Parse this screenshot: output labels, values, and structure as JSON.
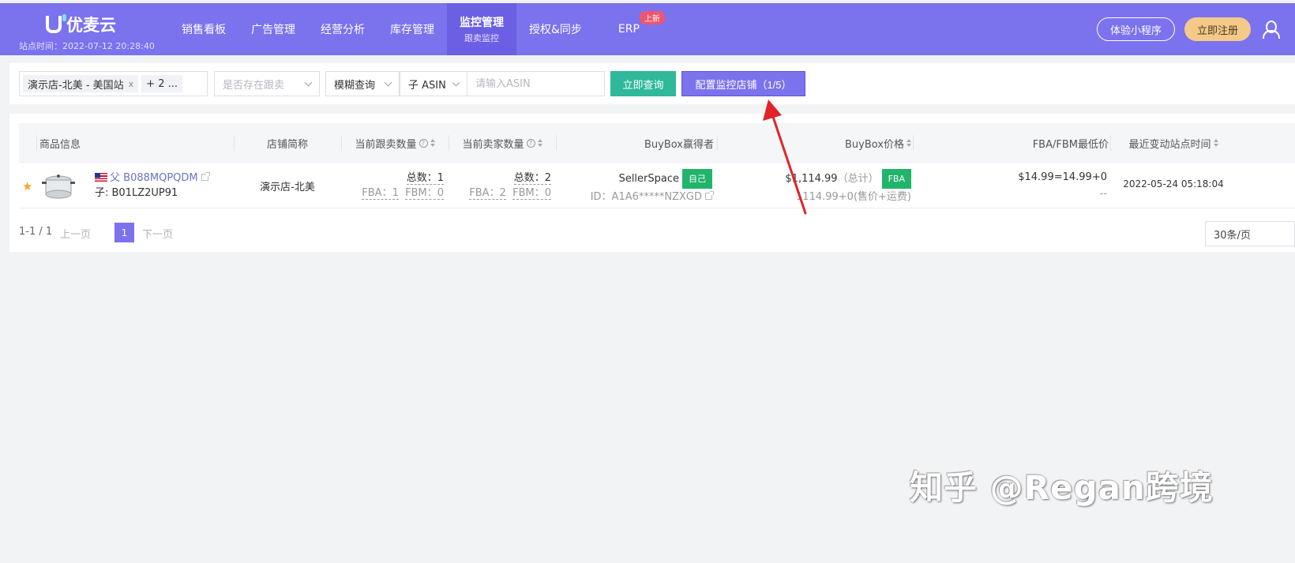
{
  "app": {
    "brand_name": "优麦云",
    "site_time": "站点时间：2022-07-12 20:28:40"
  },
  "nav": [
    {
      "label": "销售看板",
      "sub": ""
    },
    {
      "label": "广告管理",
      "sub": ""
    },
    {
      "label": "经营分析",
      "sub": ""
    },
    {
      "label": "库存管理",
      "sub": ""
    },
    {
      "label": "监控管理",
      "sub": "跟卖监控",
      "active": true
    },
    {
      "label": "授权&同步",
      "sub": ""
    },
    {
      "label": "ERP",
      "sub": "",
      "badge": "上新"
    }
  ],
  "top_actions": {
    "mini_program": "体验小程序",
    "register": "立即注册"
  },
  "filters": {
    "store_tag": "演示店-北美 - 美国站",
    "store_more": "+ 2 ...",
    "follow_select": "是否存在跟卖",
    "match_mode": "模糊查询",
    "asin_type": "子 ASIN",
    "asin_placeholder": "请输入ASIN",
    "query_button": "立即查询",
    "config_button": "配置监控店铺（1/5）"
  },
  "table": {
    "headers": {
      "product": "商品信息",
      "store": "店铺简称",
      "follow_count": "当前跟卖数量",
      "seller_count": "当前卖家数量",
      "buybox_winner": "BuyBox赢得者",
      "buybox_price": "BuyBox价格",
      "min_price": "FBA/FBM最低价",
      "last_change": "最近变动站点时间"
    },
    "rows": [
      {
        "parent_prefix": "父",
        "parent_asin": "B088MQPQDM",
        "child_asin": "子: B01LZ2UP91",
        "store": "演示店-北美",
        "follow_total": "总数：1",
        "follow_fba": "FBA：1",
        "follow_fbm": "FBM：0",
        "seller_total": "总数：2",
        "seller_fba": "FBA：2",
        "seller_fbm": "FBM：0",
        "winner_name": "SellerSpace",
        "winner_tag": "自己",
        "winner_id": "ID：A1A6*****NZXGD",
        "price_total": "$1,114.99",
        "price_total_note": "（总计）",
        "price_tag": "FBA",
        "price_detail": "1114.99+0(售价+运费)",
        "min_price": "$14.99=14.99+0",
        "min_price_sub": "--",
        "last_change": "2022-05-24 05:18:04"
      }
    ]
  },
  "pager": {
    "range": "1-1 / 1",
    "prev": "上一页",
    "current": "1",
    "next": "下一页",
    "page_size": "30条/页"
  },
  "watermark": "知乎 @Regan跨境",
  "colors": {
    "primary": "#7b72ee",
    "teal": "#2fb89a",
    "green": "#21b46b",
    "gold": "#f4c98a",
    "arrow": "#e0242b"
  }
}
